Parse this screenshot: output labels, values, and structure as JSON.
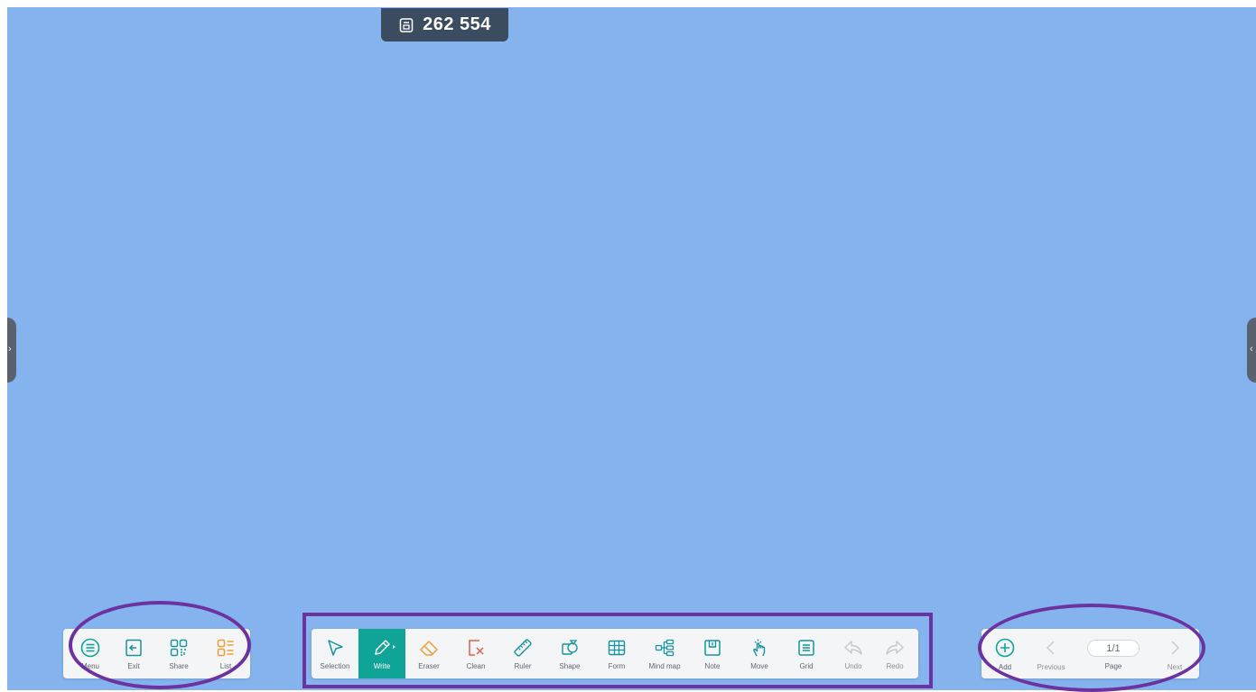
{
  "counter": {
    "icon": "card-icon",
    "value": "262 554"
  },
  "handles": {
    "left_glyph": "›",
    "right_glyph": "‹"
  },
  "left_bar": {
    "items": [
      {
        "label": "Menu",
        "icon": "menu-icon"
      },
      {
        "label": "Exit",
        "icon": "exit-icon"
      },
      {
        "label": "Share",
        "icon": "qr-share-icon"
      },
      {
        "label": "List",
        "icon": "list-icon"
      }
    ]
  },
  "toolbar": {
    "items": [
      {
        "label": "Selection",
        "icon": "cursor-icon"
      },
      {
        "label": "Write",
        "icon": "pen-icon",
        "state": "active"
      },
      {
        "label": "Eraser",
        "icon": "eraser-icon"
      },
      {
        "label": "Clean",
        "icon": "clean-icon"
      },
      {
        "label": "Ruler",
        "icon": "ruler-icon"
      },
      {
        "label": "Shape",
        "icon": "shape-icon"
      },
      {
        "label": "Form",
        "icon": "table-icon"
      },
      {
        "label": "Mind map",
        "icon": "mind-map-icon"
      },
      {
        "label": "Note",
        "icon": "note-icon"
      },
      {
        "label": "Move",
        "icon": "hand-icon"
      },
      {
        "label": "Grid",
        "icon": "grid-icon"
      },
      {
        "label": "Undo",
        "icon": "undo-icon",
        "state": "disabled"
      },
      {
        "label": "Redo",
        "icon": "redo-icon",
        "state": "disabled"
      }
    ]
  },
  "page_bar": {
    "add_label": "Add",
    "previous_label": "Previous",
    "page_value": "1/1",
    "page_label": "Page",
    "next_label": "Next"
  },
  "colors": {
    "canvas": "#85b3ee",
    "accent": "#10a398",
    "icon_teal": "#1593a0",
    "eraser": "#f0a032",
    "clean": "#e0604c",
    "list": "#f0a032",
    "annotation": "#6b32a0",
    "counter_bg": "#3c4c60"
  }
}
